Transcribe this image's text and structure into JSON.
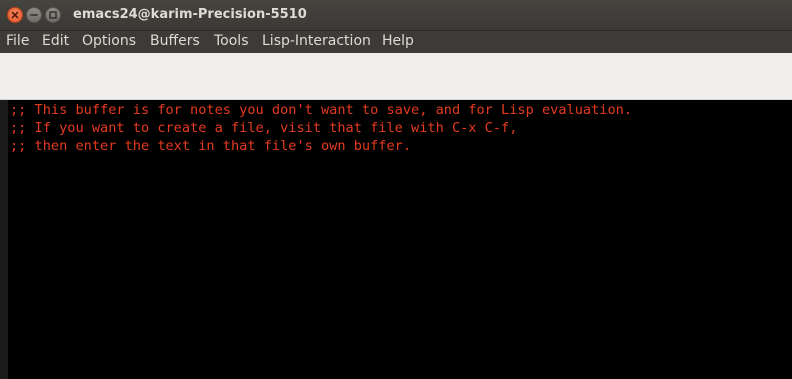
{
  "window": {
    "title": "emacs24@karim-Precision-5510"
  },
  "menu": {
    "items": [
      {
        "label": "File"
      },
      {
        "label": "Edit"
      },
      {
        "label": "Options"
      },
      {
        "label": "Buffers"
      },
      {
        "label": "Tools"
      },
      {
        "label": "Lisp-Interaction"
      },
      {
        "label": "Help"
      }
    ]
  },
  "buffer": {
    "lines": [
      ";; This buffer is for notes you don't want to save, and for Lisp evaluation.",
      ";; If you want to create a file, visit that file with C-x C-f,",
      ";; then enter the text in that file's own buffer."
    ]
  },
  "colors": {
    "comment_text": "#e43a1f",
    "editor_background": "#000000",
    "close_button": "#e0541f"
  }
}
